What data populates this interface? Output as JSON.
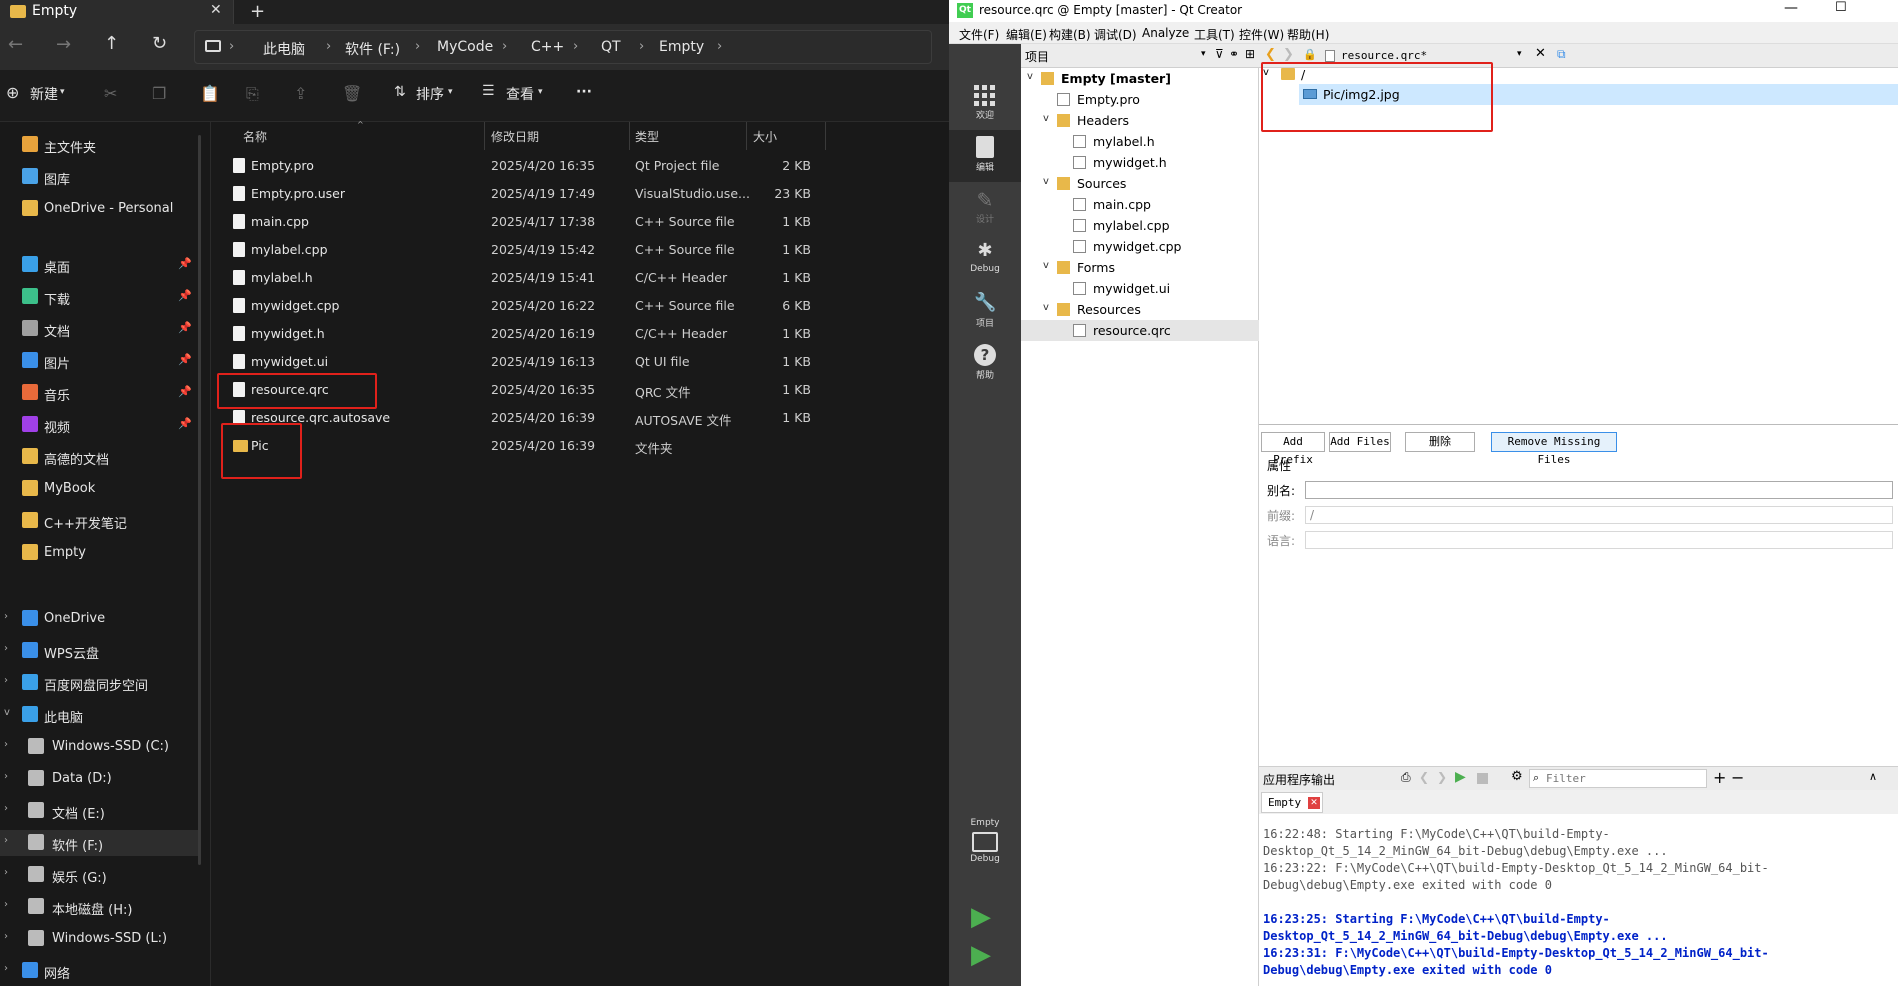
{
  "explorer": {
    "tab_title": "Empty",
    "breadcrumbs": [
      "此电脑",
      "软件 (F:)",
      "MyCode",
      "C++",
      "QT",
      "Empty"
    ],
    "toolbar": {
      "new": "新建",
      "sort": "排序",
      "view": "查看",
      "more": "···"
    },
    "columns": {
      "name": "名称",
      "date": "修改日期",
      "type": "类型",
      "size": "大小"
    },
    "files": [
      {
        "name": "Empty.pro",
        "date": "2025/4/20 16:35",
        "type": "Qt Project file",
        "size": "2 KB"
      },
      {
        "name": "Empty.pro.user",
        "date": "2025/4/19 17:49",
        "type": "VisualStudio.use...",
        "size": "23 KB"
      },
      {
        "name": "main.cpp",
        "date": "2025/4/17 17:38",
        "type": "C++ Source file",
        "size": "1 KB"
      },
      {
        "name": "mylabel.cpp",
        "date": "2025/4/19 15:42",
        "type": "C++ Source file",
        "size": "1 KB"
      },
      {
        "name": "mylabel.h",
        "date": "2025/4/19 15:41",
        "type": "C/C++ Header",
        "size": "1 KB"
      },
      {
        "name": "mywidget.cpp",
        "date": "2025/4/20 16:22",
        "type": "C++ Source file",
        "size": "6 KB"
      },
      {
        "name": "mywidget.h",
        "date": "2025/4/20 16:19",
        "type": "C/C++ Header",
        "size": "1 KB"
      },
      {
        "name": "mywidget.ui",
        "date": "2025/4/19 16:13",
        "type": "Qt UI file",
        "size": "1 KB"
      },
      {
        "name": "resource.qrc",
        "date": "2025/4/20 16:35",
        "type": "QRC 文件",
        "size": "1 KB"
      },
      {
        "name": "resource.qrc.autosave",
        "date": "2025/4/20 16:39",
        "type": "AUTOSAVE 文件",
        "size": "1 KB"
      },
      {
        "name": "Pic",
        "date": "2025/4/20 16:39",
        "type": "文件夹",
        "size": ""
      }
    ],
    "sidebar": {
      "quick": [
        {
          "label": "主文件夹",
          "color": "#e8a33c"
        },
        {
          "label": "图库",
          "color": "#4aa3e8"
        },
        {
          "label": "OneDrive - Personal",
          "color": "#e8b84a"
        }
      ],
      "pinned": [
        {
          "label": "桌面",
          "color": "#3aa0e8"
        },
        {
          "label": "下载",
          "color": "#3cc08a"
        },
        {
          "label": "文档",
          "color": "#a0a0a0"
        },
        {
          "label": "图片",
          "color": "#3a8fe8"
        },
        {
          "label": "音乐",
          "color": "#e86a3a"
        },
        {
          "label": "视频",
          "color": "#a040e8"
        },
        {
          "label": "高德的文档",
          "color": "#e8b84a"
        },
        {
          "label": "MyBook",
          "color": "#e8b84a"
        },
        {
          "label": "C++开发笔记",
          "color": "#e8b84a"
        },
        {
          "label": "Empty",
          "color": "#e8b84a"
        }
      ],
      "drives": [
        {
          "label": "OneDrive",
          "color": "#3a8fe8"
        },
        {
          "label": "WPS云盘",
          "color": "#3a8fe8"
        },
        {
          "label": "百度网盘同步空间",
          "color": "#3aa0e8"
        },
        {
          "label": "此电脑",
          "color": "#3aa0e8"
        },
        {
          "label": "Windows-SSD (C:)",
          "color": "#bbbbbb"
        },
        {
          "label": "Data (D:)",
          "color": "#bbbbbb"
        },
        {
          "label": "文档 (E:)",
          "color": "#bbbbbb"
        },
        {
          "label": "软件 (F:)",
          "color": "#bbbbbb"
        },
        {
          "label": "娱乐 (G:)",
          "color": "#bbbbbb"
        },
        {
          "label": "本地磁盘 (H:)",
          "color": "#bbbbbb"
        },
        {
          "label": "Windows-SSD (L:)",
          "color": "#bbbbbb"
        },
        {
          "label": "网络",
          "color": "#3a8fe8"
        }
      ]
    }
  },
  "qt": {
    "window_title": "resource.qrc @ Empty [master] - Qt Creator",
    "menu": [
      "文件(F)",
      "编辑(E)",
      "构建(B)",
      "调试(D)",
      "Analyze",
      "工具(T)",
      "控件(W)",
      "帮助(H)"
    ],
    "modes": [
      "欢迎",
      "编辑",
      "设计",
      "Debug",
      "项目",
      "帮助"
    ],
    "project_panel_title": "项目",
    "tree": [
      {
        "label": "Empty [master]",
        "indent": 0,
        "arrow": "v",
        "kind": "proj"
      },
      {
        "label": "Empty.pro",
        "indent": 1,
        "arrow": "",
        "kind": "file"
      },
      {
        "label": "Headers",
        "indent": 1,
        "arrow": "v",
        "kind": "folder"
      },
      {
        "label": "mylabel.h",
        "indent": 2,
        "arrow": "",
        "kind": "h"
      },
      {
        "label": "mywidget.h",
        "indent": 2,
        "arrow": "",
        "kind": "h"
      },
      {
        "label": "Sources",
        "indent": 1,
        "arrow": "v",
        "kind": "folder"
      },
      {
        "label": "main.cpp",
        "indent": 2,
        "arrow": "",
        "kind": "cpp"
      },
      {
        "label": "mylabel.cpp",
        "indent": 2,
        "arrow": "",
        "kind": "cpp"
      },
      {
        "label": "mywidget.cpp",
        "indent": 2,
        "arrow": "",
        "kind": "cpp"
      },
      {
        "label": "Forms",
        "indent": 1,
        "arrow": "v",
        "kind": "folder"
      },
      {
        "label": "mywidget.ui",
        "indent": 2,
        "arrow": "",
        "kind": "ui"
      },
      {
        "label": "Resources",
        "indent": 1,
        "arrow": "v",
        "kind": "folder"
      },
      {
        "label": "resource.qrc",
        "indent": 2,
        "arrow": "",
        "kind": "qrc"
      }
    ],
    "editor_tab": "resource.qrc*",
    "qrc_prefix": "/",
    "qrc_file": "Pic/img2.jpg",
    "buttons": {
      "add_prefix": "Add Prefix",
      "add_files": "Add Files",
      "delete": "删除",
      "remove_missing": "Remove Missing Files"
    },
    "props": {
      "title": "属性",
      "alias": "别名:",
      "prefix": "前缀:",
      "prefix_value": "/",
      "lang": "语言:"
    },
    "output": {
      "title": "应用程序输出",
      "filter_placeholder": "Filter",
      "tab": "Empty",
      "lines": [
        {
          "text": "16:22:48: Starting F:\\MyCode\\C++\\QT\\build-Empty-",
          "style": "gray"
        },
        {
          "text": "Desktop_Qt_5_14_2_MinGW_64_bit-Debug\\debug\\Empty.exe ...",
          "style": "gray"
        },
        {
          "text": "16:23:22: F:\\MyCode\\C++\\QT\\build-Empty-Desktop_Qt_5_14_2_MinGW_64_bit-",
          "style": "gray"
        },
        {
          "text": "Debug\\debug\\Empty.exe exited with code 0",
          "style": "gray"
        },
        {
          "text": "",
          "style": "gray"
        },
        {
          "text": "16:23:25: Starting F:\\MyCode\\C++\\QT\\build-Empty-",
          "style": "blue"
        },
        {
          "text": "Desktop_Qt_5_14_2_MinGW_64_bit-Debug\\debug\\Empty.exe ...",
          "style": "blue"
        },
        {
          "text": "16:23:31: F:\\MyCode\\C++\\QT\\build-Empty-Desktop_Qt_5_14_2_MinGW_64_bit-",
          "style": "blue"
        },
        {
          "text": "Debug\\debug\\Empty.exe exited with code 0",
          "style": "blue"
        }
      ]
    },
    "kit": {
      "project": "Empty",
      "mode": "Debug"
    }
  }
}
